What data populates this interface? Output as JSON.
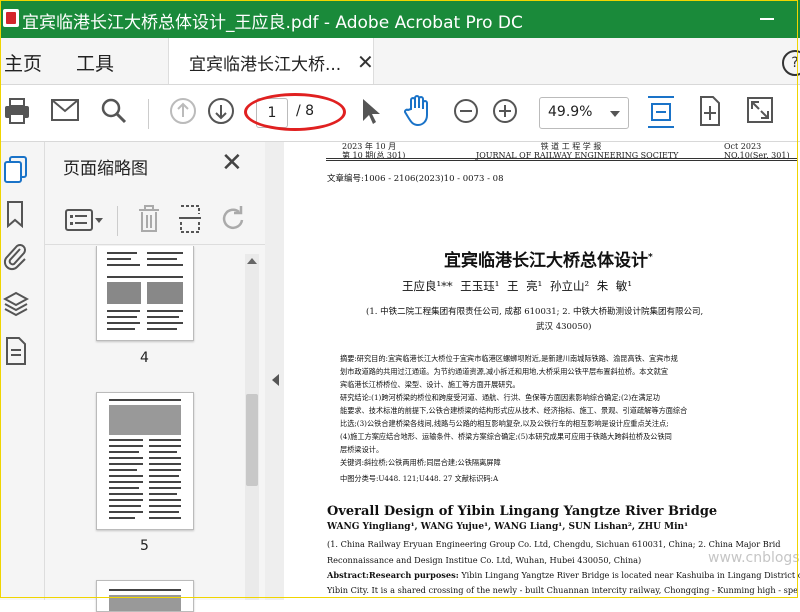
{
  "window": {
    "title": "宜宾临港长江大桥总体设计_王应良.pdf - Adobe Acrobat Pro DC"
  },
  "menubar": {
    "home": "主页",
    "tools": "工具",
    "doc_tab": "宜宾临港长江大桥..."
  },
  "toolbar": {
    "current_page": "1",
    "total_pages": "/ 8",
    "zoom": "49.9%"
  },
  "thumbnails": {
    "panel_title": "页面缩略图",
    "pages": [
      {
        "label": "4"
      },
      {
        "label": "5"
      }
    ]
  },
  "document": {
    "header_left_line1": "2023 年 10 月",
    "header_left_line2": "第 10 期(总 301)",
    "header_center_line1": "铁   道   工   程   学   报",
    "header_center_line2": "JOURNAL OF RAILWAY ENGINEERING SOCIETY",
    "header_right_line1": "Oct    2023",
    "header_right_line2": "NO.10(Ser. 301)",
    "article_no": "文章编号:1006 - 2106(2023)10 - 0073 - 08",
    "title_cn": "宜宾临港长江大桥总体设计",
    "title_mark": "*",
    "authors_cn": "王应良¹** 王玉珏¹ 王 亮¹ 孙立山² 朱 敏¹",
    "affil_cn_line1": "(1. 中铁二院工程集团有限责任公司, 成都 610031; 2. 中铁大桥勘测设计院集团有限公司,",
    "affil_cn_line2": "武汉 430050)",
    "abstract_cn_lines": [
      "摘要:研究目的:宜宾临港长江大桥位于宜宾市临港区螺蛳坝附近,是新建川南城际铁路、渝昆高铁、宜宾市规",
      "划市政道路的共用过江通道。为节约通道资源,减小拆迁和用地,大桥采用公铁平层布置斜拉桥。本文就宜",
      "宾临港长江桥桥位、梁型、设计、施工等方面开展研究。",
      "    研究结论:(1)跨河桥梁的桥位和跨度受河道、通航、行洪、鱼保等方面因素影响综合确定;(2)在满足功",
      "能要求、技术标准的前提下,公铁合建桥梁的结构形式应从技术、经济指标、施工、景观、引道疏解等方面综合",
      "比选;(3)公铁合建桥梁各线间,线路与公路的相互影响复杂,以及公铁行车的相互影响是设计应重点关注点;",
      "(4)施工方案应结合地形、运输条件、桥梁方案综合确定;(5)本研究成果可应用于铁路大跨斜拉桥及公铁同",
      "层桥梁设计。",
      "关键词:斜拉桥;公铁两用桥;同层合建;公铁隔离屏障",
      "中图分类号:U448. 121;U448. 27        文献标识码:A"
    ],
    "title_en": "Overall Design of Yibin Lingang Yangtze River Bridge",
    "authors_en": "WANG Yingliang¹, WANG Yujue¹, WANG Liang¹, SUN Lishan², ZHU Min¹",
    "affil_en_line1": "(1. China Railway Eryuan Engineering Group Co. Ltd, Chengdu, Sichuan 610031, China; 2. China Major Brid",
    "affil_en_line2": "Reconnaissance and Design Institue Co. Ltd, Wuhan, Hubei 430050, China)",
    "abstract_en_label": "Abstract:Research purposes:",
    "abstract_en_line1": "Yibin Lingang Yangtze River Bridge is located near Kashuiba in Lingang District of th",
    "abstract_en_line2": "Yibin City. It is a shared crossing of the newly - built Chuannan intercity railway, Chongqing - Kunming high - spe"
  },
  "watermark": "www.cnblogs.com"
}
